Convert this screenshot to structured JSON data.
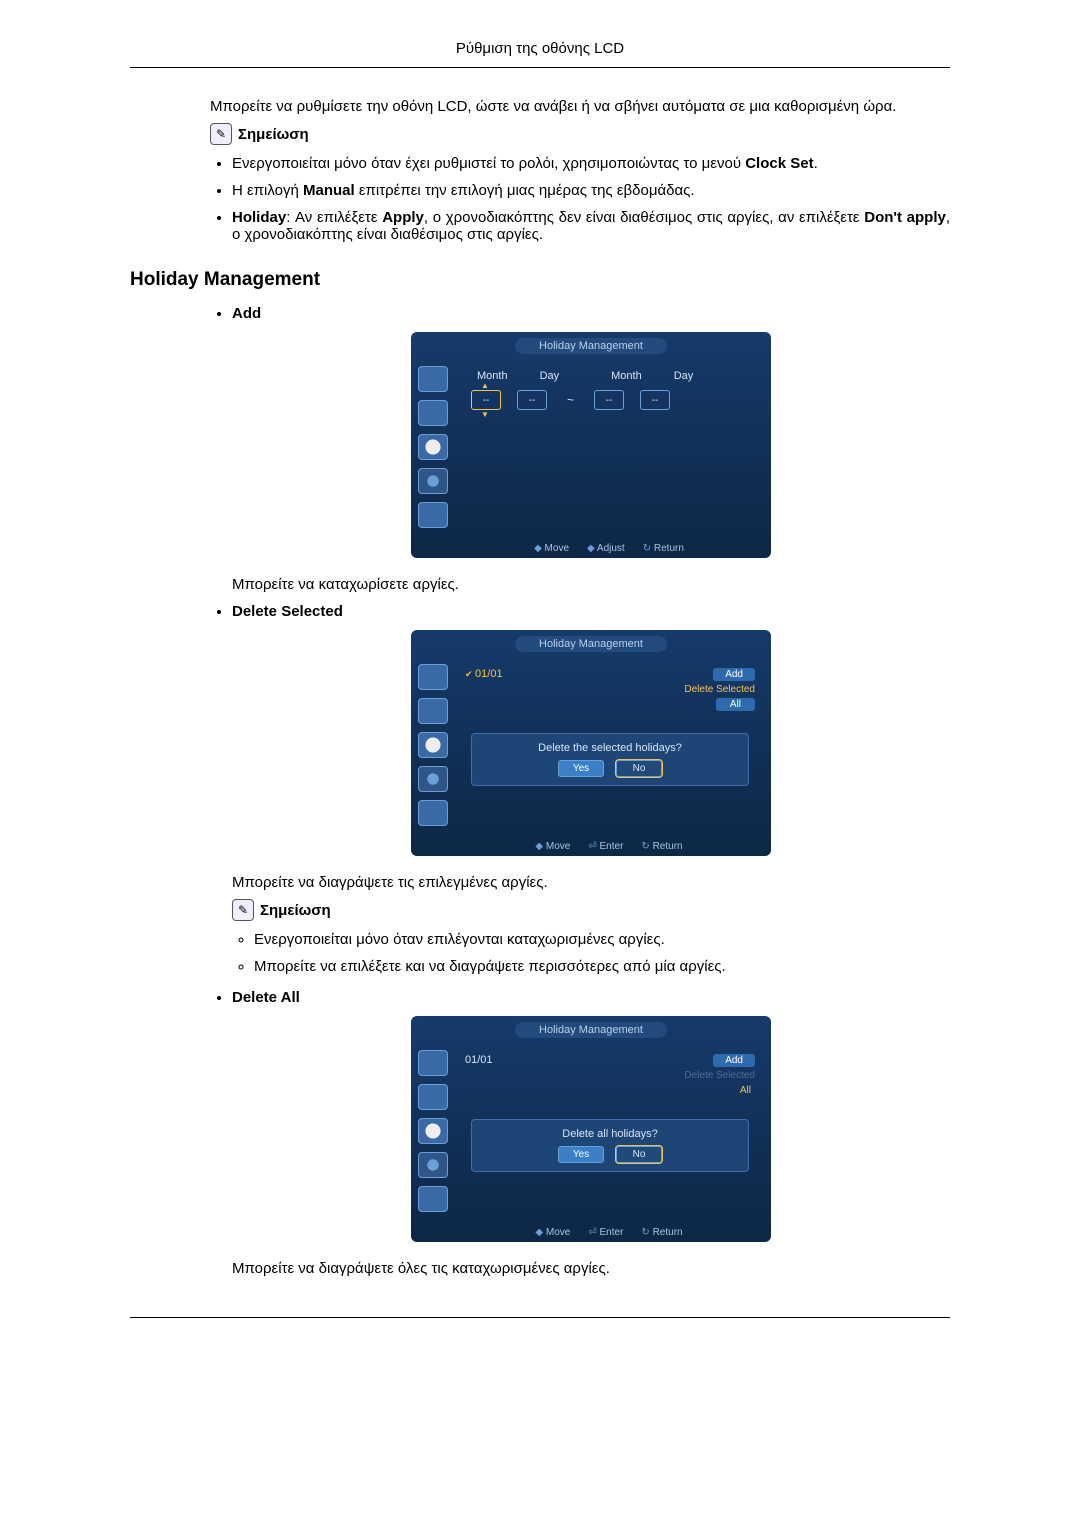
{
  "header": "Ρύθμιση της οθόνης LCD",
  "intro": "Μπορείτε να ρυθμίσετε την οθόνη LCD, ώστε να ανάβει ή να σβήνει αυτόματα σε μια καθορισμένη ώρα.",
  "noteLabel": "Σημείωση",
  "notes1": {
    "n1_pre": "Ενεργοποιείται μόνο όταν έχει ρυθμιστεί το ρολόι, χρησιμοποιώντας το μενού ",
    "n1_b": "Clock Set",
    "n1_post": ".",
    "n2_pre": "Η επιλογή ",
    "n2_b": "Manual",
    "n2_post": " επιτρέπει την επιλογή μιας ημέρας της εβδομάδας.",
    "n3_b1": "Holiday",
    "n3_t1": ": Αν επιλέξετε ",
    "n3_b2": "Apply",
    "n3_t2": ", ο χρονοδιακόπτης δεν είναι διαθέσιμος στις αργίες, αν επιλέξετε ",
    "n3_b3": "Don't apply",
    "n3_t3": ", ο χρονοδιακόπτης είναι διαθέσιμος στις αργίες."
  },
  "sectionTitle": "Holiday Management",
  "add": {
    "label": "Add",
    "osdTitle": "Holiday Management",
    "monthLabel": "Month",
    "dayLabel": "Day",
    "val": "--",
    "footer": {
      "move": "Move",
      "adjust": "Adjust",
      "ret": "Return"
    },
    "caption": "Μπορείτε να καταχωρίσετε αργίες."
  },
  "delSel": {
    "label": "Delete Selected",
    "osdTitle": "Holiday Management",
    "date": "01/01",
    "addBtn": "Add",
    "delBtn": "Delete Selected",
    "allBtn": "All",
    "promptText": "Delete the selected holidays?",
    "yes": "Yes",
    "no": "No",
    "footer": {
      "move": "Move",
      "enter": "Enter",
      "ret": "Return"
    },
    "caption": "Μπορείτε να διαγράψετε τις επιλεγμένες αργίες.",
    "notes": {
      "a": "Ενεργοποιείται μόνο όταν επιλέγονται καταχωρισμένες αργίες.",
      "b": "Μπορείτε να επιλέξετε και να διαγράψετε περισσότερες από μία αργίες."
    }
  },
  "delAll": {
    "label": "Delete All",
    "osdTitle": "Holiday Management",
    "date": "01/01",
    "addBtn": "Add",
    "delBtn": "Delete Selected",
    "allBtn": "All",
    "promptText": "Delete all holidays?",
    "yes": "Yes",
    "no": "No",
    "footer": {
      "move": "Move",
      "enter": "Enter",
      "ret": "Return"
    },
    "caption": "Μπορείτε να διαγράψετε όλες τις καταχωρισμένες αργίες."
  }
}
